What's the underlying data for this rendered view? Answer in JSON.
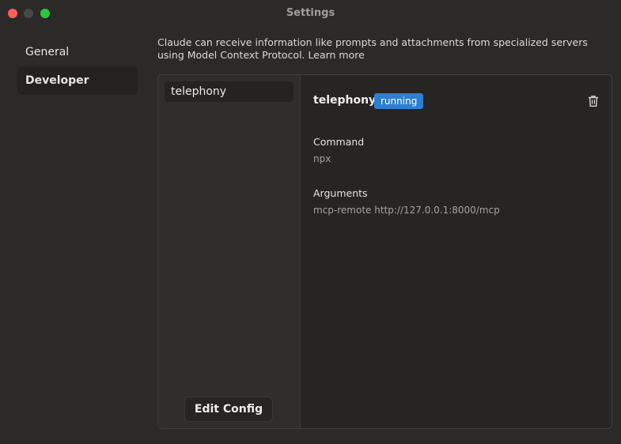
{
  "window": {
    "title": "Settings"
  },
  "nav": {
    "items": [
      {
        "label": "General",
        "active": false
      },
      {
        "label": "Developer",
        "active": true
      }
    ]
  },
  "developer": {
    "description": "Claude can receive information like prompts and attachments from specialized servers using Model Context Protocol.",
    "learn_more": "Learn more",
    "servers": [
      {
        "name": "telephony"
      }
    ],
    "edit_config_label": "Edit Config",
    "selected": {
      "name": "telephony",
      "status": "running",
      "command_label": "Command",
      "command_value": "npx",
      "arguments_label": "Arguments",
      "arguments_value": "mcp-remote http://127.0.0.1:8000/mcp"
    }
  },
  "colors": {
    "status_running": "#2f7fd1",
    "background": "#2b2a29"
  },
  "icons": {
    "delete": "trash-icon"
  }
}
